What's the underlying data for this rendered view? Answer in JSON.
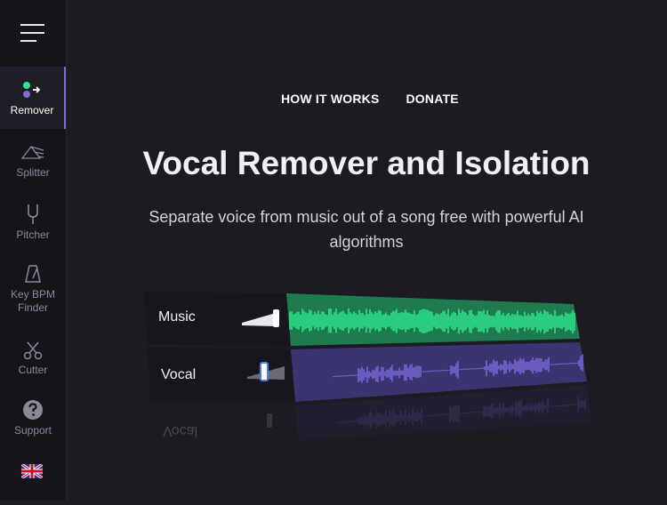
{
  "sidebar": {
    "items": [
      {
        "key": "remover",
        "label": "Remover",
        "icon": "remover-icon",
        "active": true
      },
      {
        "key": "splitter",
        "label": "Splitter",
        "icon": "splitter-icon",
        "active": false
      },
      {
        "key": "pitcher",
        "label": "Pitcher",
        "icon": "tuning-fork-icon",
        "active": false
      },
      {
        "key": "bpm",
        "label": "Key BPM Finder",
        "icon": "metronome-icon",
        "active": false
      },
      {
        "key": "cutter",
        "label": "Cutter",
        "icon": "scissors-icon",
        "active": false
      },
      {
        "key": "support",
        "label": "Support",
        "icon": "help-icon",
        "active": false
      }
    ],
    "language_icon": "uk-flag-icon"
  },
  "nav": {
    "how_it_works": "HOW IT WORKS",
    "donate": "DONATE"
  },
  "hero": {
    "title": "Vocal Remover and Isolation",
    "subtitle": "Separate voice from music out of a song free with powerful AI algorithms"
  },
  "tracks": [
    {
      "label": "Music",
      "color": "#2ee88f",
      "panel": "#1f7a4f"
    },
    {
      "label": "Vocal",
      "color": "#7b6ad8",
      "panel": "#3a3470"
    }
  ],
  "colors": {
    "accent": "#7b6ad8",
    "green": "#2ee88f",
    "background": "#1c1b22"
  }
}
